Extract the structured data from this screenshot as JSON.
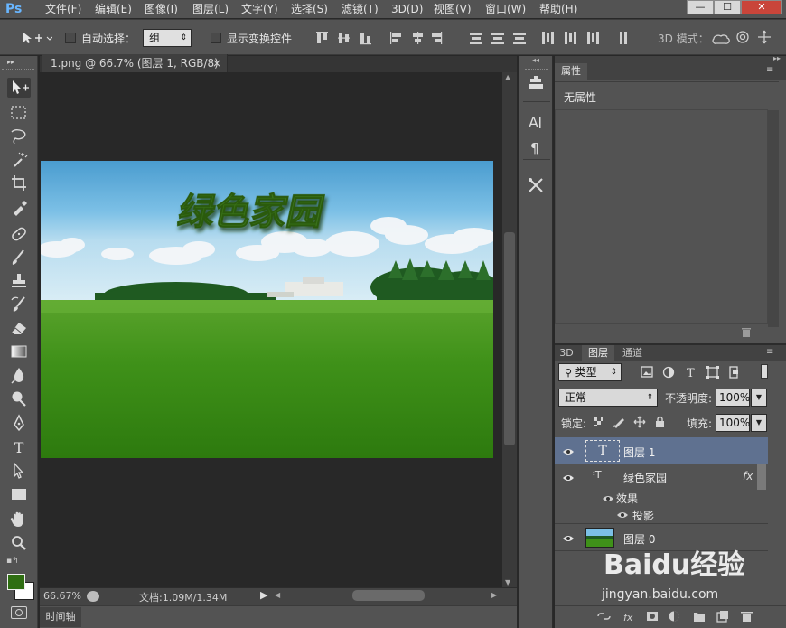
{
  "app": {
    "logo": "Ps",
    "menu": [
      "文件(F)",
      "编辑(E)",
      "图像(I)",
      "图层(L)",
      "文字(Y)",
      "选择(S)",
      "滤镜(T)",
      "3D(D)",
      "视图(V)",
      "窗口(W)",
      "帮助(H)"
    ],
    "window_controls": [
      "—",
      "☐",
      "✕"
    ]
  },
  "options_bar": {
    "auto_select_label": "自动选择：",
    "auto_select_value": "组",
    "show_transform_label": "显示变换控件",
    "mode_3d_label": "3D 模式："
  },
  "document": {
    "tab_title": "1.png @ 66.7% (图层 1, RGB/8) *",
    "close_glyph": "×",
    "zoom": "66.67%",
    "doc_info": "文档:1.09M/1.34M",
    "canvas_text": "绿色家园"
  },
  "timeline": {
    "label": "时间轴"
  },
  "properties": {
    "tab": "属性",
    "body": "无属性"
  },
  "layers_panel": {
    "tabs": [
      "3D",
      "图层",
      "通道"
    ],
    "filter_kind": "类型",
    "blend_mode": "正常",
    "opacity_label": "不透明度:",
    "opacity_value": "100%",
    "lock_label": "锁定:",
    "fill_label": "填充:",
    "fill_value": "100%",
    "layers": [
      {
        "name": "图层 1",
        "type": "text",
        "selected": true
      },
      {
        "name": "绿色家园",
        "type": "style-source"
      },
      {
        "name": "图层 0",
        "type": "image"
      }
    ],
    "effects_label": "效果",
    "effect_item": "投影",
    "fx_glyph": "fx"
  },
  "watermark": {
    "brand": "Baidu经验",
    "url": "jingyan.baidu.com"
  }
}
